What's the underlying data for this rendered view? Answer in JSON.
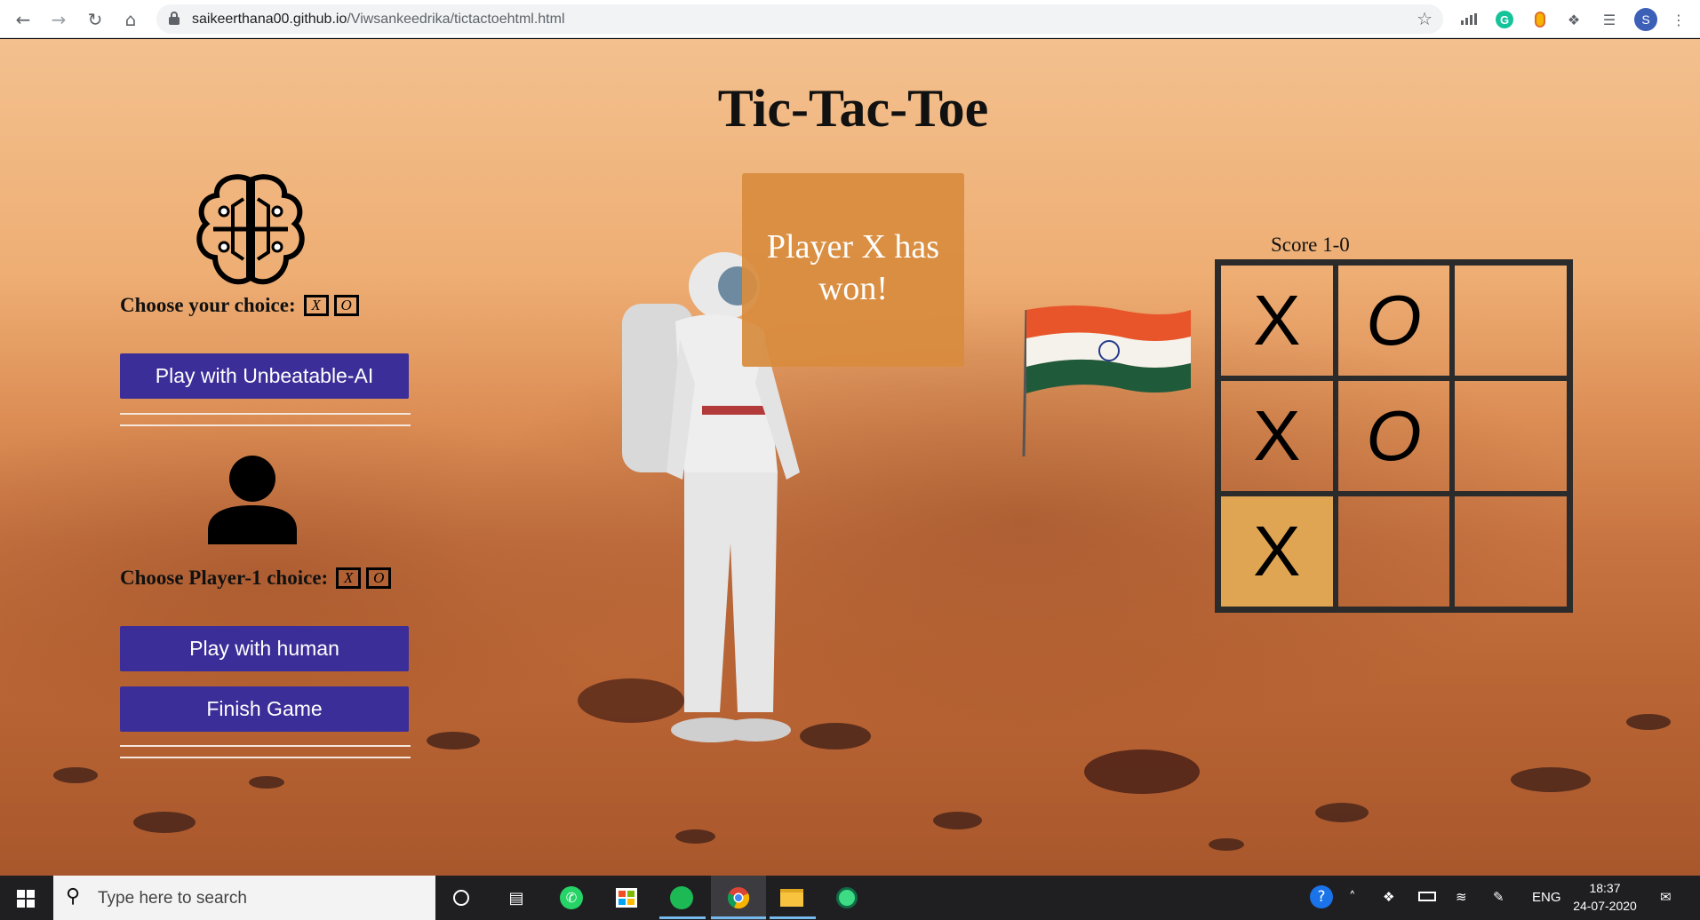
{
  "browser": {
    "url_host": "saikeerthana00.github.io",
    "url_path": "/Viwsankeedrika/tictactoehtml.html",
    "profile_initial": "S"
  },
  "game": {
    "title": "Tic-Tac-Toe",
    "choose_your_choice": "Choose your choice:",
    "choose_player1_choice": "Choose Player-1 choice:",
    "x_option": "X",
    "o_option": "O",
    "play_ai_button": "Play with Unbeatable-AI",
    "play_human_button": "Play with human",
    "finish_button": "Finish Game",
    "status_message": "Player X has won!",
    "score": "Score 1-0",
    "board": [
      [
        "X",
        "O",
        ""
      ],
      [
        "X",
        "O",
        ""
      ],
      [
        "X",
        "",
        ""
      ]
    ],
    "winning_cell": "row 3, column 1",
    "button_color": "#3b2e98",
    "status_color": "#d88c3e",
    "highlight_color": "#e0a552"
  },
  "taskbar": {
    "search_placeholder": "Type here to search",
    "language": "ENG",
    "time": "18:37",
    "date": "24-07-2020"
  }
}
